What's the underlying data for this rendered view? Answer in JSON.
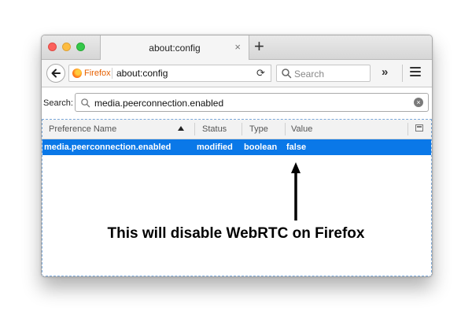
{
  "tab": {
    "title": "about:config",
    "close": "×",
    "new_tab": "+"
  },
  "nav": {
    "browser_label": "Firefox",
    "url": "about:config",
    "reload": "⟳",
    "search_placeholder": "Search",
    "overflow": "»"
  },
  "filter": {
    "label": "Search:",
    "value": "media.peerconnection.enabled"
  },
  "table": {
    "columns": [
      "Preference Name",
      "Status",
      "Type",
      "Value"
    ],
    "rows": [
      {
        "name": "media.peerconnection.enabled",
        "status": "modified",
        "type": "boolean",
        "value": "false"
      }
    ]
  },
  "annotation": "This will disable WebRTC on Firefox",
  "colors": {
    "selection": "#0a78e8",
    "firefox_orange": "#e66000"
  }
}
